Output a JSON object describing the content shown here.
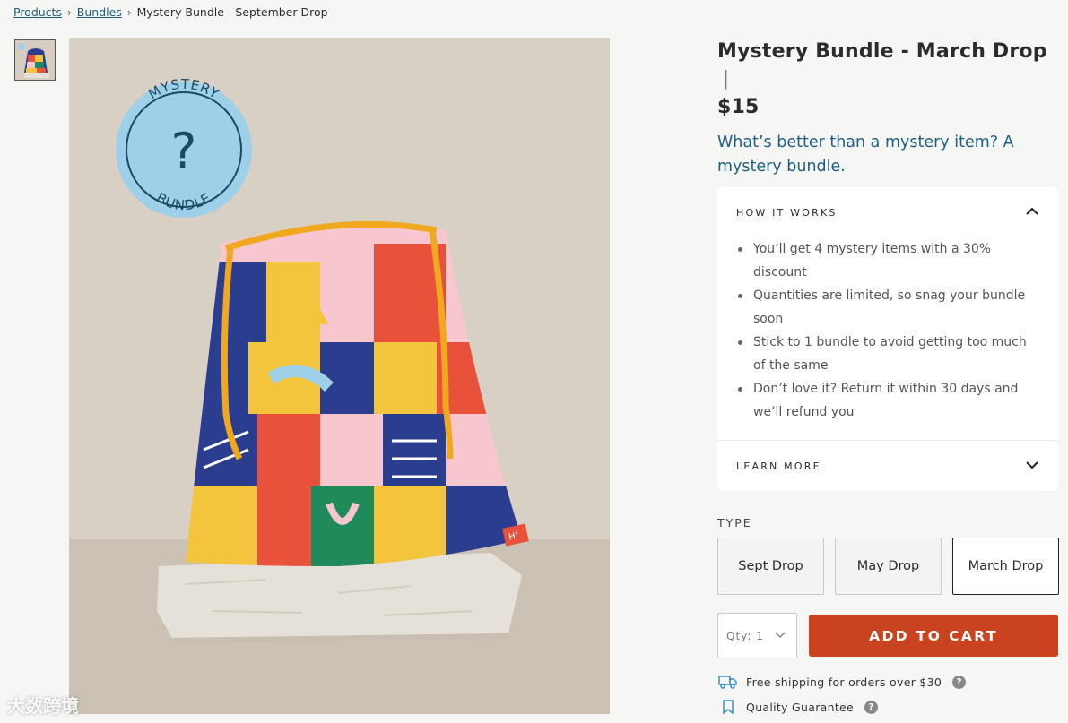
{
  "breadcrumb": {
    "items": [
      "Products",
      "Bundles"
    ],
    "current": "Mystery Bundle - September Drop",
    "separator": "›"
  },
  "badge": {
    "line1": "MYSTERY",
    "line2": "BUNDLE",
    "mark": "?"
  },
  "product_tag": "H'",
  "product": {
    "title": "Mystery Bundle - March Drop",
    "pipe": "|",
    "price": "$15",
    "tagline": "What’s better than a mystery item? A mystery bundle."
  },
  "accordion": {
    "how_it_works": {
      "label": "HOW IT WORKS",
      "icon": "chevron-up-icon",
      "items": [
        "You’ll get 4 mystery items with a 30% discount",
        "Quantities are limited, so snag your bundle soon",
        "Stick to 1 bundle to avoid getting too much of the same",
        "Don’t love it? Return it within 30 days and we’ll refund you"
      ]
    },
    "learn_more": {
      "label": "LEARN MORE",
      "icon": "chevron-down-icon"
    }
  },
  "type": {
    "label": "TYPE",
    "options": [
      "Sept Drop",
      "May Drop",
      "March Drop"
    ],
    "selected": "March Drop"
  },
  "cart": {
    "qty_label": "Qty: 1",
    "add_label": "ADD TO CART",
    "button_color": "#c9431e"
  },
  "info": {
    "shipping": "Free shipping for orders over $30",
    "guarantee": "Quality Guarantee",
    "help_mark": "?"
  },
  "watermark": "大数跨境",
  "colors": {
    "link": "#1c5d7a",
    "tagline": "#1d5f80",
    "accent": "#c9431e",
    "badge": "#9fd0ea"
  }
}
